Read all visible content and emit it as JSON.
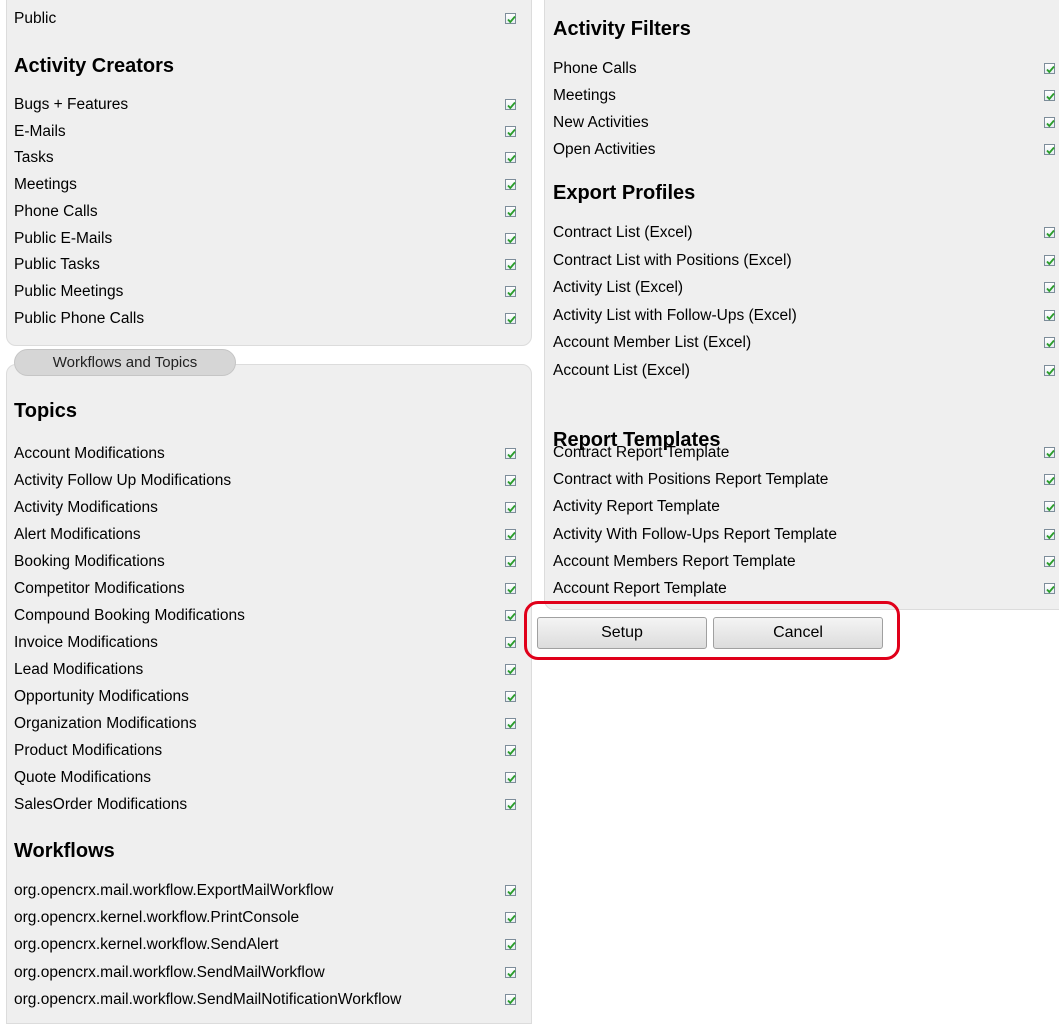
{
  "left_top": {
    "public_row": {
      "label": "Public",
      "checked": true
    },
    "activity_creators": {
      "title": "Activity Creators",
      "items": [
        {
          "label": "Bugs + Features",
          "checked": true
        },
        {
          "label": "E-Mails",
          "checked": true
        },
        {
          "label": "Tasks",
          "checked": true
        },
        {
          "label": "Meetings",
          "checked": true
        },
        {
          "label": "Phone Calls",
          "checked": true
        },
        {
          "label": "Public E-Mails",
          "checked": true
        },
        {
          "label": "Public Tasks",
          "checked": true
        },
        {
          "label": "Public Meetings",
          "checked": true
        },
        {
          "label": "Public Phone Calls",
          "checked": true
        }
      ]
    }
  },
  "workflows_tab": {
    "label": "Workflows and Topics"
  },
  "topics": {
    "title": "Topics",
    "items": [
      {
        "label": "Account Modifications",
        "checked": true
      },
      {
        "label": "Activity Follow Up Modifications",
        "checked": true
      },
      {
        "label": "Activity Modifications",
        "checked": true
      },
      {
        "label": "Alert Modifications",
        "checked": true
      },
      {
        "label": "Booking Modifications",
        "checked": true
      },
      {
        "label": "Competitor Modifications",
        "checked": true
      },
      {
        "label": "Compound Booking Modifications",
        "checked": true
      },
      {
        "label": "Invoice Modifications",
        "checked": true
      },
      {
        "label": "Lead Modifications",
        "checked": true
      },
      {
        "label": "Opportunity Modifications",
        "checked": true
      },
      {
        "label": "Organization Modifications",
        "checked": true
      },
      {
        "label": "Product Modifications",
        "checked": true
      },
      {
        "label": "Quote Modifications",
        "checked": true
      },
      {
        "label": "SalesOrder Modifications",
        "checked": true
      }
    ]
  },
  "workflows": {
    "title": "Workflows",
    "items": [
      {
        "label": "org.opencrx.mail.workflow.ExportMailWorkflow",
        "checked": true
      },
      {
        "label": "org.opencrx.kernel.workflow.PrintConsole",
        "checked": true
      },
      {
        "label": "org.opencrx.kernel.workflow.SendAlert",
        "checked": true
      },
      {
        "label": "org.opencrx.mail.workflow.SendMailWorkflow",
        "checked": true
      },
      {
        "label": "org.opencrx.mail.workflow.SendMailNotificationWorkflow",
        "checked": true
      }
    ]
  },
  "activity_filters": {
    "title": "Activity Filters",
    "items": [
      {
        "label": "Phone Calls",
        "checked": true
      },
      {
        "label": "Meetings",
        "checked": true
      },
      {
        "label": "New Activities",
        "checked": true
      },
      {
        "label": "Open Activities",
        "checked": true
      }
    ]
  },
  "export_profiles": {
    "title": "Export Profiles",
    "items": [
      {
        "label": "Contract List (Excel)",
        "checked": true
      },
      {
        "label": "Contract List with Positions (Excel)",
        "checked": true
      },
      {
        "label": "Activity List (Excel)",
        "checked": true
      },
      {
        "label": "Activity List with Follow-Ups (Excel)",
        "checked": true
      },
      {
        "label": "Account Member List (Excel)",
        "checked": true
      },
      {
        "label": "Account List (Excel)",
        "checked": true
      }
    ]
  },
  "report_templates": {
    "title": "Report Templates",
    "items": [
      {
        "label": "Contract Report Template",
        "checked": true
      },
      {
        "label": "Contract with Positions Report Template",
        "checked": true
      },
      {
        "label": "Activity Report Template",
        "checked": true
      },
      {
        "label": "Activity With Follow-Ups Report Template",
        "checked": true
      },
      {
        "label": "Account Members Report Template",
        "checked": true
      },
      {
        "label": "Account Report Template",
        "checked": true
      }
    ]
  },
  "actions": {
    "setup_label": "Setup",
    "cancel_label": "Cancel"
  },
  "colors": {
    "check": "#2a9d2a",
    "highlight": "#e0001a",
    "panel": "#efefef"
  }
}
